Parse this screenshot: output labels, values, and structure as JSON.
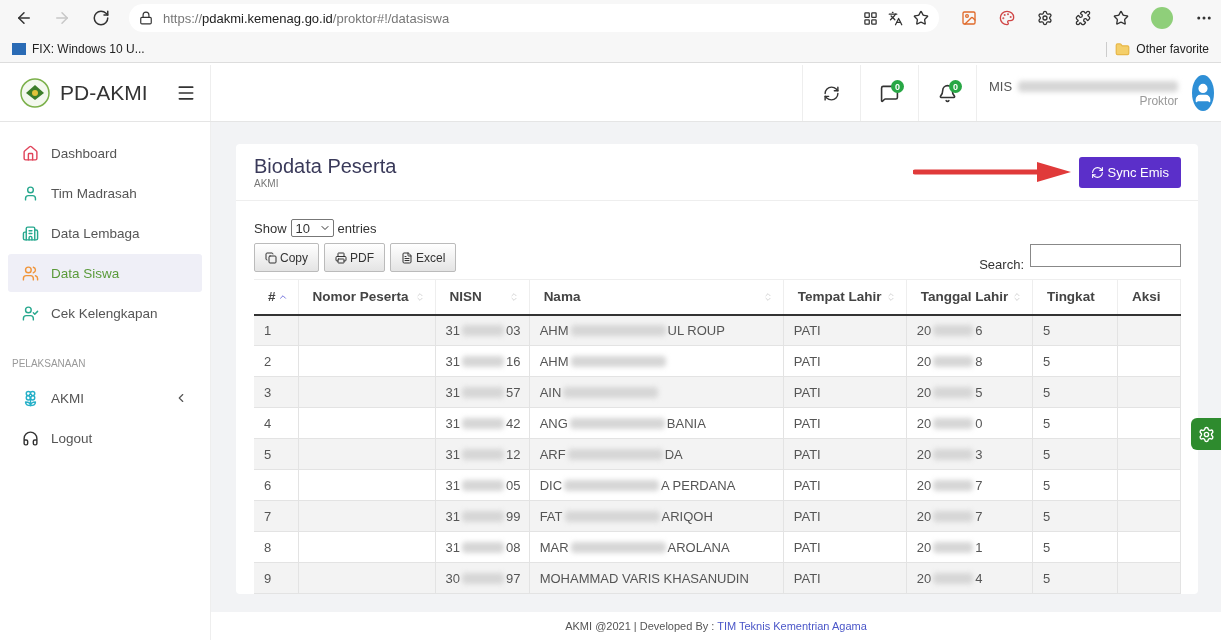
{
  "browser": {
    "url_scheme": "https://",
    "url_host": "pdakmi.kemenag.go.id",
    "url_path": "/proktor#!/datasiswa",
    "forward_disabled": true,
    "bookmarks": [
      {
        "label": "FIX: Windows 10 U..."
      }
    ],
    "other_favorites": "Other favorite"
  },
  "app": {
    "brand": "PD-AKMI"
  },
  "header": {
    "messages_badge": "0",
    "notifications_badge": "0",
    "user_prefix": "MIS",
    "user_role": "Proktor"
  },
  "sidebar": {
    "items": [
      {
        "kind": "home",
        "label": "Dashboard",
        "selected": false
      },
      {
        "kind": "user",
        "label": "Tim Madrasah",
        "selected": false
      },
      {
        "kind": "building",
        "label": "Data Lembaga",
        "selected": false
      },
      {
        "kind": "users",
        "label": "Data Siswa",
        "selected": true
      },
      {
        "kind": "check",
        "label": "Cek Kelengkapan",
        "selected": false
      }
    ],
    "section": "PELAKSANAAN",
    "section_items": [
      {
        "kind": "lotus",
        "label": "AKMI",
        "expanded": false
      },
      {
        "kind": "headset",
        "label": "Logout"
      }
    ]
  },
  "card": {
    "title": "Biodata Peserta",
    "subtitle": "AKMI",
    "action": "Sync Emis"
  },
  "table_controls": {
    "show_label": "Show",
    "page_size": "10",
    "entries_label": "entries",
    "search_label": "Search:",
    "buttons": [
      {
        "kind": "copy",
        "label": "Copy"
      },
      {
        "kind": "pdf",
        "label": "PDF"
      },
      {
        "kind": "excel",
        "label": "Excel"
      }
    ]
  },
  "table": {
    "columns": [
      {
        "label": "#",
        "sortable": true,
        "sorted": true
      },
      {
        "label": "Nomor Peserta",
        "sortable": true,
        "sorted": false
      },
      {
        "label": "NISN",
        "sortable": true,
        "sorted": false
      },
      {
        "label": "Nama",
        "sortable": true,
        "sorted": false
      },
      {
        "label": "Tempat Lahir",
        "sortable": true,
        "sorted": false
      },
      {
        "label": "Tanggal Lahir",
        "sortable": true,
        "sorted": false
      },
      {
        "label": "Tingkat",
        "sortable": false
      },
      {
        "label": "Aksi",
        "sortable": false
      }
    ],
    "rows": [
      {
        "no": "1",
        "nisn": [
          "31",
          "03"
        ],
        "nama": [
          "AHM",
          "UL ROUP"
        ],
        "tempat": "PATI",
        "tanggal": [
          "20",
          "6"
        ],
        "tingkat": "5"
      },
      {
        "no": "2",
        "nisn": [
          "31",
          "16"
        ],
        "nama": [
          "AHM"
        ],
        "tempat": "PATI",
        "tanggal": [
          "20",
          "8"
        ],
        "tingkat": "5"
      },
      {
        "no": "3",
        "nisn": [
          "31",
          "57"
        ],
        "nama": [
          "AIN"
        ],
        "tempat": "PATI",
        "tanggal": [
          "20",
          "5"
        ],
        "tingkat": "5"
      },
      {
        "no": "4",
        "nisn": [
          "31",
          "42"
        ],
        "nama": [
          "ANG",
          "BANIA"
        ],
        "tempat": "PATI",
        "tanggal": [
          "20",
          "0"
        ],
        "tingkat": "5"
      },
      {
        "no": "5",
        "nisn": [
          "31",
          "12"
        ],
        "nama": [
          "ARF",
          "DA"
        ],
        "tempat": "PATI",
        "tanggal": [
          "20",
          "3"
        ],
        "tingkat": "5"
      },
      {
        "no": "6",
        "nisn": [
          "31",
          "05"
        ],
        "nama": [
          "DIC",
          "A PERDANA"
        ],
        "tempat": "PATI",
        "tanggal": [
          "20",
          "7"
        ],
        "tingkat": "5"
      },
      {
        "no": "7",
        "nisn": [
          "31",
          "99"
        ],
        "nama": [
          "FAT",
          "ARIQOH"
        ],
        "tempat": "PATI",
        "tanggal": [
          "20",
          "7"
        ],
        "tingkat": "5"
      },
      {
        "no": "8",
        "nisn": [
          "31",
          "08"
        ],
        "nama": [
          "MAR",
          "AROLANA"
        ],
        "tempat": "PATI",
        "tanggal": [
          "20",
          "1"
        ],
        "tingkat": "5"
      },
      {
        "no": "9",
        "nisn": [
          "30",
          "97"
        ],
        "nama": [
          "MOHAMMAD VARIS KHASANUDIN"
        ],
        "tempat": "PATI",
        "tanggal": [
          "20",
          "4"
        ],
        "tingkat": "5"
      }
    ]
  },
  "footer": {
    "text": "AKMI @2021 | Developed By : ",
    "link": "TIM Teknis Kementrian Agama"
  }
}
